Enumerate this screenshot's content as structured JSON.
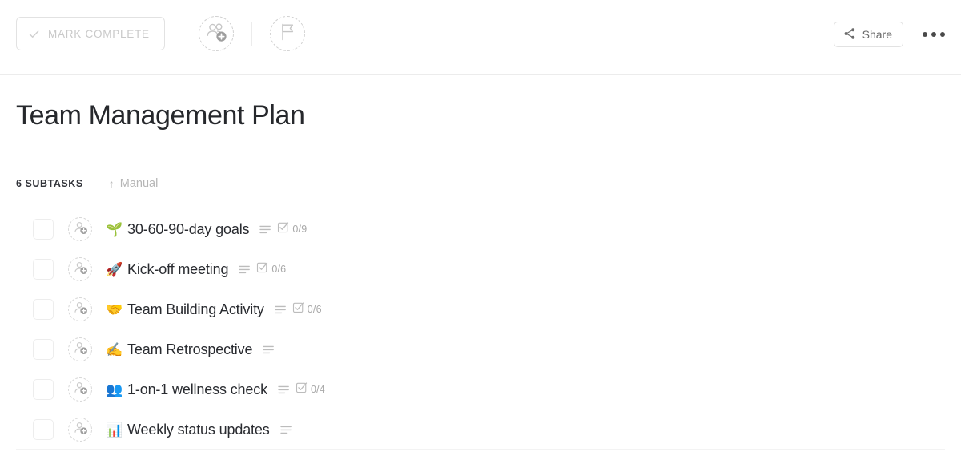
{
  "toolbar": {
    "mark_complete_label": "MARK COMPLETE",
    "mark_complete_icon": "check-icon",
    "assignee_icon": "add-assignee-icon",
    "flag_icon": "flag-icon",
    "share_label": "Share",
    "share_icon": "share-icon",
    "more_icon": "more-options-icon",
    "colors": {
      "muted_text": "#c9c9c9",
      "border": "#e2e2e2",
      "divider": "#ececec",
      "title_text": "#26282c"
    }
  },
  "page": {
    "title": "Team Management Plan"
  },
  "subtasks_header": {
    "count_label": "6 SUBTASKS",
    "sort_arrow": "↑",
    "sort_label": "Manual",
    "sort_icon": "sort-ascending-icon"
  },
  "subtasks": [
    {
      "checkbox": "unchecked",
      "assignee_icon": "add-assignee-icon",
      "emoji": "🌱",
      "emoji_name": "seedling-emoji",
      "title": "30-60-90-day goals",
      "has_description": true,
      "description_icon": "description-icon",
      "has_checklist": true,
      "checklist_icon": "checklist-icon",
      "checklist_count": "0/9"
    },
    {
      "checkbox": "unchecked",
      "assignee_icon": "add-assignee-icon",
      "emoji": "🚀",
      "emoji_name": "rocket-emoji",
      "title": "Kick-off meeting",
      "has_description": true,
      "description_icon": "description-icon",
      "has_checklist": true,
      "checklist_icon": "checklist-icon",
      "checklist_count": "0/6"
    },
    {
      "checkbox": "unchecked",
      "assignee_icon": "add-assignee-icon",
      "emoji": "🤝",
      "emoji_name": "handshake-emoji",
      "title": "Team Building Activity",
      "has_description": true,
      "description_icon": "description-icon",
      "has_checklist": true,
      "checklist_icon": "checklist-icon",
      "checklist_count": "0/6"
    },
    {
      "checkbox": "unchecked",
      "assignee_icon": "add-assignee-icon",
      "emoji": "✍️",
      "emoji_name": "writing-hand-emoji",
      "title": "Team Retrospective",
      "has_description": true,
      "description_icon": "description-icon",
      "has_checklist": false,
      "checklist_icon": "",
      "checklist_count": ""
    },
    {
      "checkbox": "unchecked",
      "assignee_icon": "add-assignee-icon",
      "emoji": "👥",
      "emoji_name": "busts-in-silhouette-emoji",
      "title": "1-on-1 wellness check",
      "has_description": true,
      "description_icon": "description-icon",
      "has_checklist": true,
      "checklist_icon": "checklist-icon",
      "checklist_count": "0/4"
    },
    {
      "checkbox": "unchecked",
      "assignee_icon": "add-assignee-icon",
      "emoji": "📊",
      "emoji_name": "bar-chart-emoji",
      "title": "Weekly status updates",
      "has_description": true,
      "description_icon": "description-icon",
      "has_checklist": false,
      "checklist_icon": "",
      "checklist_count": ""
    }
  ]
}
